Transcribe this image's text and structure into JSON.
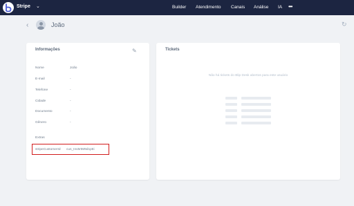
{
  "topbar": {
    "bot_name": "Stripe",
    "nav": [
      "Builder",
      "Atendimento",
      "Canais",
      "Análise",
      "IA"
    ],
    "more": "•••"
  },
  "header": {
    "back": "‹",
    "contact_name": "João",
    "refresh": "↻"
  },
  "info_card": {
    "title": "Informações",
    "edit_icon": "✎",
    "fields": [
      {
        "label": "Nome",
        "value": "João"
      },
      {
        "label": "E-mail",
        "value": "-"
      },
      {
        "label": "Telefone",
        "value": "-"
      },
      {
        "label": "Cidade",
        "value": "-"
      },
      {
        "label": "Documento",
        "value": "-"
      },
      {
        "label": "Gênero",
        "value": "-"
      }
    ],
    "extras_title": "Extras",
    "extras": [
      {
        "label": "stripeCustomerId",
        "value": "cus_Inv5rtM9d1ptIi"
      }
    ]
  },
  "tickets_card": {
    "title": "Tickets",
    "empty_message": "Não há tickets do Blip Desk abertos para este usuário"
  },
  "colors": {
    "topbar": "#1c2541",
    "highlight_border": "#d11a1a",
    "background": "#f0f2f5"
  },
  "icons": [
    "blip-logo-icon",
    "chevron-down-icon",
    "more-icon",
    "back-arrow-icon",
    "user-avatar-icon",
    "refresh-icon",
    "edit-pencil-icon"
  ]
}
